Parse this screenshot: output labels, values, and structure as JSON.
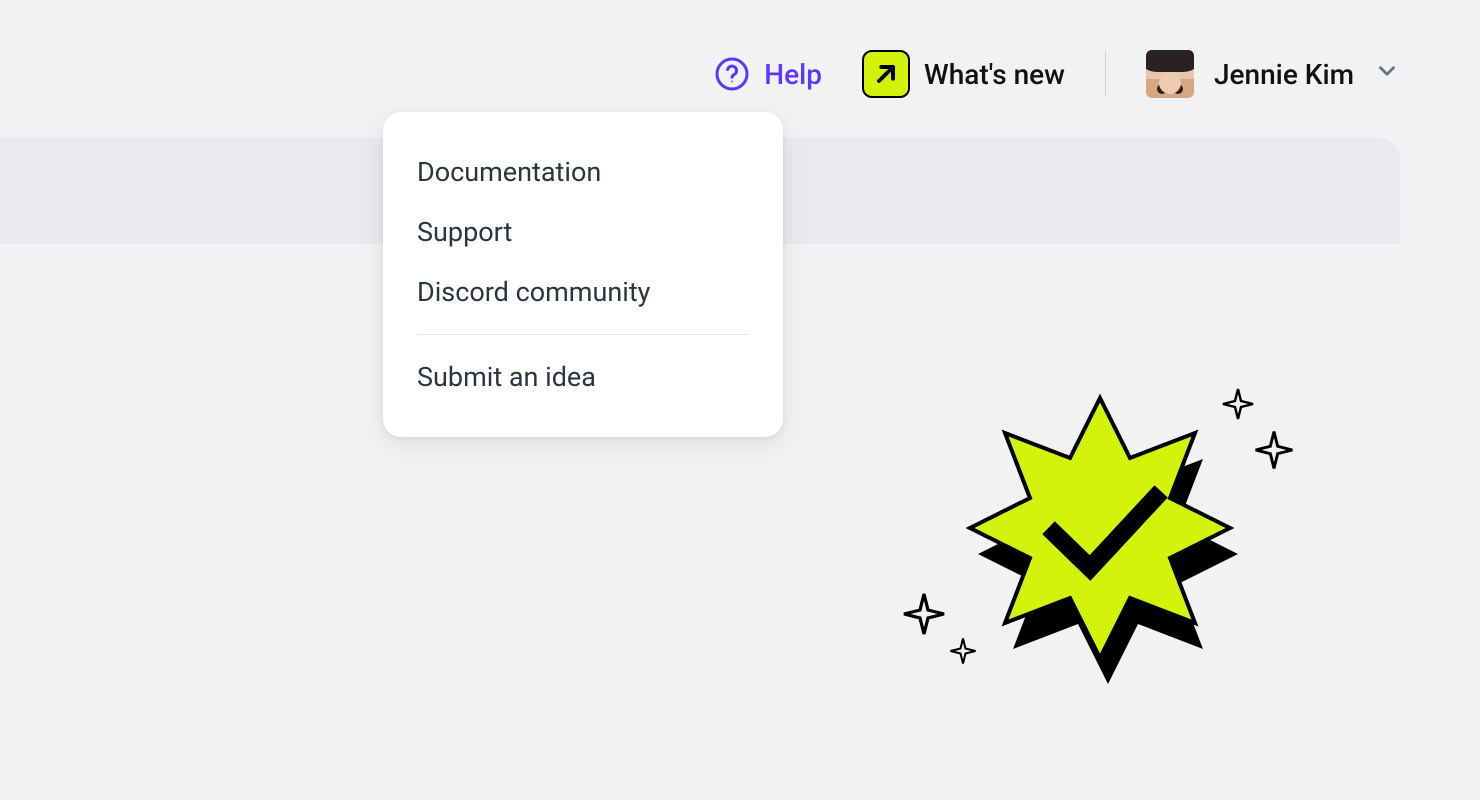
{
  "topbar": {
    "help_label": "Help",
    "whatsnew_label": "What's new",
    "user_name": "Jennie Kim"
  },
  "help_menu": {
    "items": [
      {
        "label": "Documentation"
      },
      {
        "label": "Support"
      },
      {
        "label": "Discord community"
      }
    ],
    "footer_item": {
      "label": "Submit an idea"
    }
  },
  "colors": {
    "accent_purple": "#5b36ff",
    "accent_lime": "#d4f30b"
  }
}
